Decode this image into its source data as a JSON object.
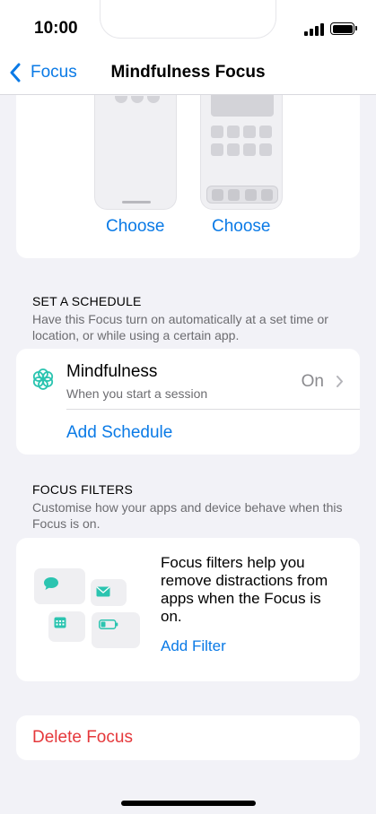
{
  "status_bar": {
    "time": "10:00"
  },
  "nav": {
    "back_label": "Focus",
    "title": "Mindfulness Focus"
  },
  "home_screen": {
    "choose_left": "Choose",
    "choose_right": "Choose"
  },
  "schedule": {
    "header": "SET A SCHEDULE",
    "description": "Have this Focus turn on automatically at a set time or location, or while using a certain app.",
    "item_title": "Mindfulness",
    "item_subtitle": "When you start a session",
    "item_status": "On",
    "add_label": "Add Schedule"
  },
  "filters": {
    "header": "FOCUS FILTERS",
    "description": "Customise how your apps and device behave when this Focus is on.",
    "info_text": "Focus filters help you remove distractions from apps when the Focus is on.",
    "add_label": "Add Filter"
  },
  "delete": {
    "label": "Delete Focus"
  },
  "colors": {
    "accent": "#0a7ae6",
    "destructive": "#e5383b",
    "mint": "#2bc4b0"
  }
}
